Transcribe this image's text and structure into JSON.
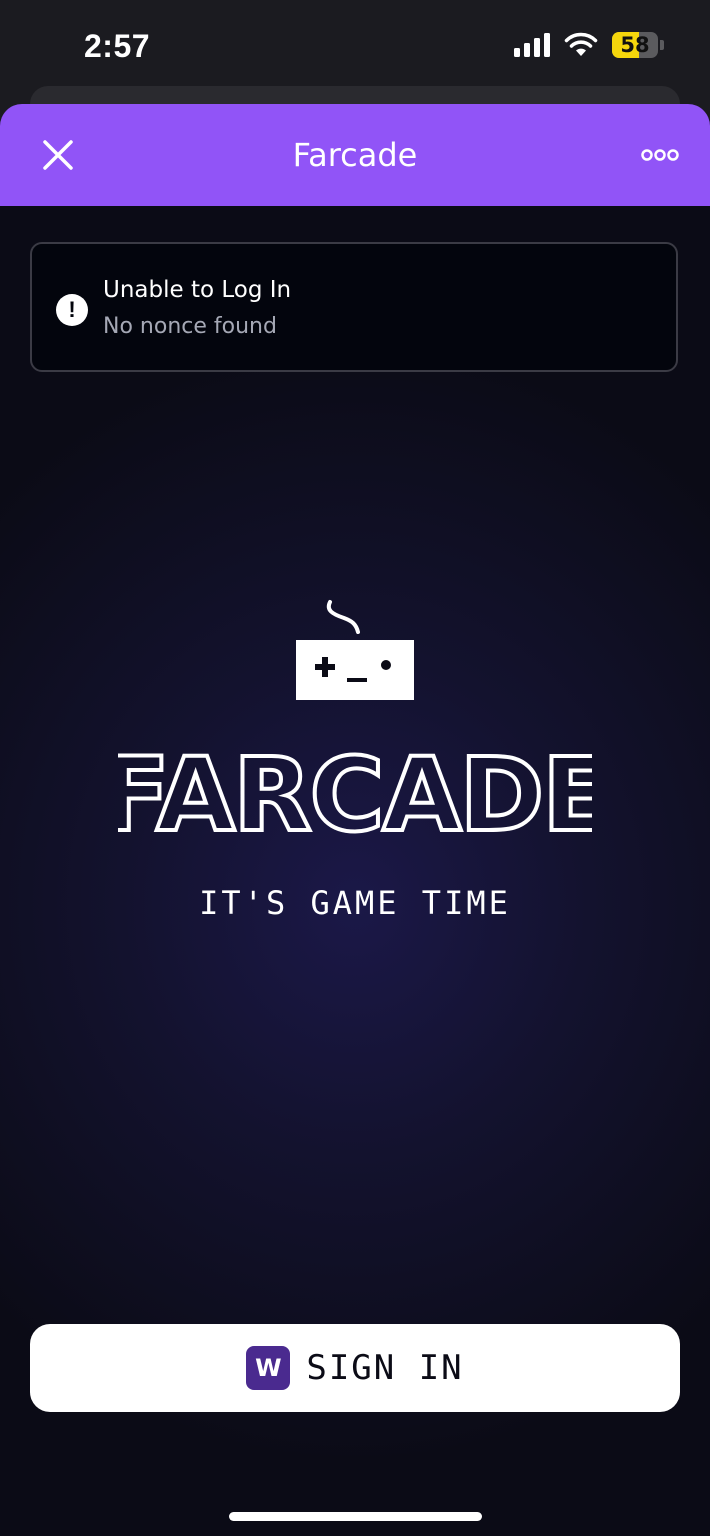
{
  "status_bar": {
    "time": "2:57",
    "battery_percent": 58,
    "battery_label": "58",
    "icons": [
      "cellular-signal-icon",
      "wifi-icon",
      "battery-icon"
    ]
  },
  "header": {
    "title": "Farcade",
    "background": "#9154f7",
    "icons": [
      "close-icon",
      "more-options-icon"
    ]
  },
  "toast": {
    "title": "Unable to Log In",
    "message": "No nonce found",
    "icon": "exclamation-circle-icon"
  },
  "logo": {
    "wordmark": "FARCADE",
    "icon": "game-controller-icon"
  },
  "tagline": "IT'S GAME TIME",
  "sign_in": {
    "badge_letter": "W",
    "label": "SIGN IN"
  }
}
